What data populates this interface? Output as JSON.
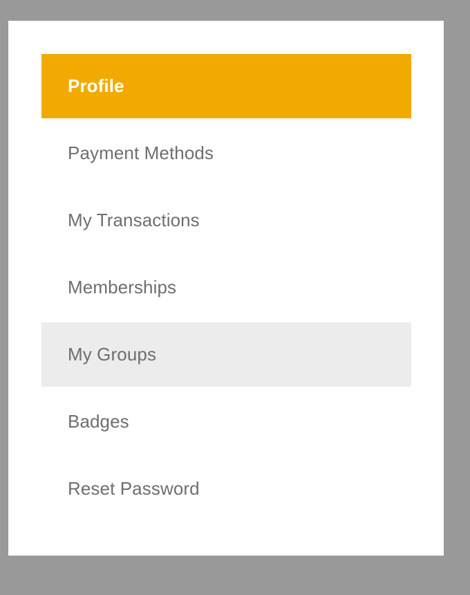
{
  "sidebar": {
    "accent_color": "#f2aa00",
    "hover_color": "#ececec",
    "active_index": 0,
    "hover_index": 4,
    "items": [
      {
        "label": "Profile"
      },
      {
        "label": "Payment Methods"
      },
      {
        "label": "My Transactions"
      },
      {
        "label": "Memberships"
      },
      {
        "label": "My Groups"
      },
      {
        "label": "Badges"
      },
      {
        "label": "Reset Password"
      }
    ]
  }
}
